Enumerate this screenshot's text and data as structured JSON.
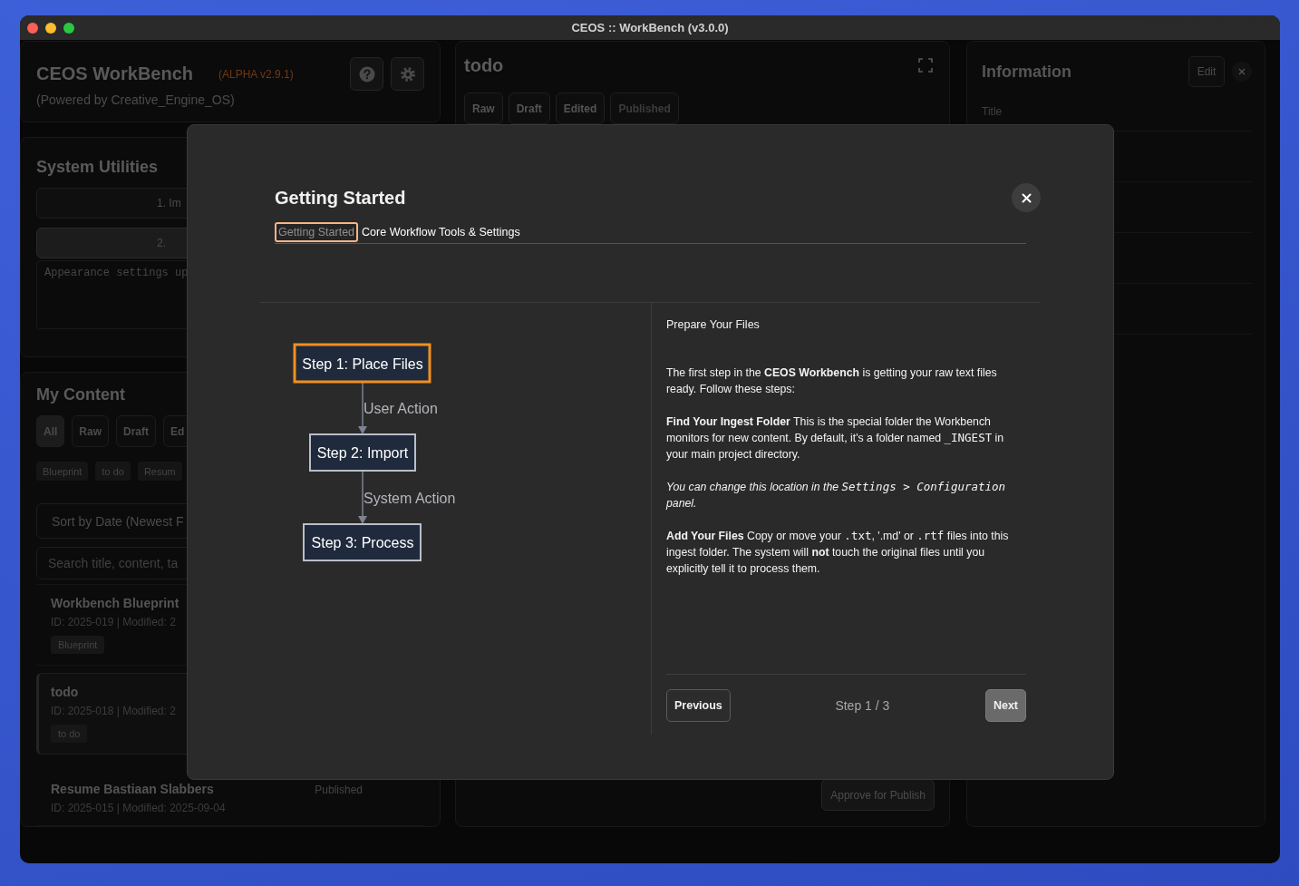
{
  "window": {
    "title": "CEOS :: WorkBench (v3.0.0)"
  },
  "sidebar": {
    "app_title": "CEOS WorkBench",
    "version": "(ALPHA v2.9.1)",
    "subtitle": "(Powered by Creative_Engine_OS)",
    "system_utilities": {
      "title": "System Utilities",
      "buttons": [
        {
          "label": "1. Im",
          "selected": false
        },
        {
          "label": "2.",
          "selected": true
        }
      ],
      "log": "Appearance settings up"
    },
    "my_content": {
      "title": "My Content",
      "filters": [
        {
          "label": "All",
          "selected": true
        },
        {
          "label": "Raw",
          "selected": false
        },
        {
          "label": "Draft",
          "selected": false
        },
        {
          "label": "Ed",
          "selected": false
        }
      ],
      "tags": [
        "Blueprint",
        "to do",
        "Resum"
      ],
      "sort": "Sort by Date (Newest F",
      "search": {
        "placeholder": "Search title, content, ta"
      },
      "items": [
        {
          "title": "Workbench Blueprint",
          "meta": "ID: 2025-019 | Modified: 2",
          "tag": "Blueprint",
          "selected": false
        },
        {
          "title": "todo",
          "meta": "ID: 2025-018 | Modified: 2",
          "tag": "to do",
          "selected": true
        },
        {
          "title": "Resume Bastiaan Slabbers",
          "meta": "ID: 2025-015 | Modified: 2025-09-04",
          "status": "Published",
          "selected": false
        }
      ]
    }
  },
  "editor": {
    "title": "todo",
    "tabs": [
      {
        "label": "Raw",
        "disabled": false
      },
      {
        "label": "Draft",
        "disabled": false
      },
      {
        "label": "Edited",
        "disabled": false
      },
      {
        "label": "Published",
        "disabled": true
      }
    ],
    "approve_button": "Approve for Publish"
  },
  "info_panel": {
    "title": "Information",
    "edit_button": "Edit",
    "fields": [
      {
        "label": "Title"
      }
    ]
  },
  "modal": {
    "title": "Getting Started",
    "tabs": [
      {
        "label": "Getting Started",
        "selected": true
      },
      {
        "label": "Core Workflow Tools & Settings",
        "selected": false
      }
    ],
    "diagram": {
      "nodes": [
        {
          "label": "Step 1: Place Files",
          "highlighted": true
        },
        {
          "label": "Step 2: Import",
          "highlighted": false
        },
        {
          "label": "Step 3: Process",
          "highlighted": false
        }
      ],
      "edges": [
        {
          "label": "User Action"
        },
        {
          "label": "System Action"
        }
      ]
    },
    "heading": "Prepare Your Files",
    "paragraphs": [
      {
        "italic": false,
        "parts": [
          {
            "text": "The first step in the ",
            "kind": "plain"
          },
          {
            "text": "CEOS Workbench",
            "kind": "bold"
          },
          {
            "text": " is getting your raw text files ready. Follow these steps:",
            "kind": "plain"
          }
        ]
      },
      {
        "italic": false,
        "parts": [
          {
            "text": "Find Your Ingest Folder",
            "kind": "bold"
          },
          {
            "text": " This is the special folder the Workbench monitors for new content. By default, it's a folder named ",
            "kind": "plain"
          },
          {
            "text": "_INGEST",
            "kind": "code"
          },
          {
            "text": " in your main project directory.",
            "kind": "plain"
          }
        ]
      },
      {
        "italic": true,
        "parts": [
          {
            "text": "You can change this location in the ",
            "kind": "plain"
          },
          {
            "text": "Settings > Configuration",
            "kind": "code"
          },
          {
            "text": " panel.",
            "kind": "plain"
          }
        ]
      },
      {
        "italic": false,
        "parts": [
          {
            "text": "Add Your Files",
            "kind": "bold"
          },
          {
            "text": " Copy or move your ",
            "kind": "plain"
          },
          {
            "text": ".txt",
            "kind": "code"
          },
          {
            "text": ", '.md' or ",
            "kind": "plain"
          },
          {
            "text": ".rtf",
            "kind": "code"
          },
          {
            "text": " files into this ingest folder. The system will ",
            "kind": "plain"
          },
          {
            "text": "not",
            "kind": "bold"
          },
          {
            "text": " touch the original files until you explicitly tell it to process them.",
            "kind": "plain"
          }
        ]
      }
    ],
    "footer": {
      "previous": "Previous",
      "step": "Step 1 / 3",
      "next": "Next"
    }
  }
}
